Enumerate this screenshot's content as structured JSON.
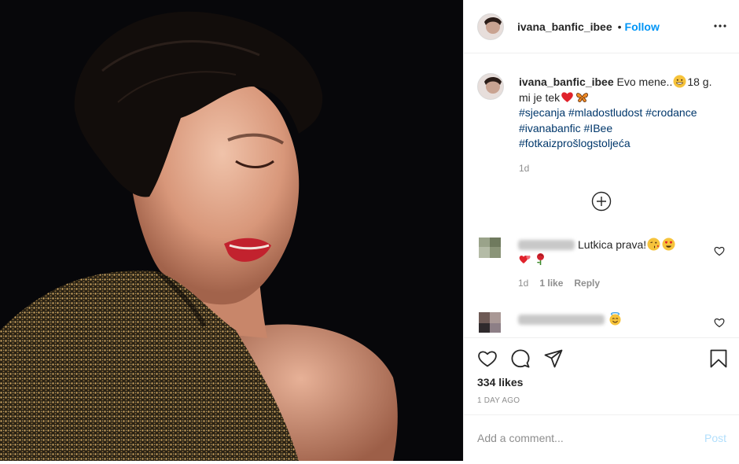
{
  "post": {
    "username": "ivana_banfic_ibee",
    "follow_label": "Follow",
    "separator": "•"
  },
  "caption": {
    "username": "ivana_banfic_ibee",
    "text_1": "Evo mene..",
    "text_2": "18 g.",
    "text_3": "mi je tek",
    "hashtags_line1": [
      "#sjecanja",
      "#mladostludost",
      "#crodance"
    ],
    "hashtags_line2": [
      "#ivanabanfic",
      "#IBee"
    ],
    "hashtags_line3": [
      "#fotkaizprošlogstoljeća"
    ],
    "time": "1d"
  },
  "comments": [
    {
      "text": "Lutkica prava!",
      "time": "1d",
      "likes": "1 like",
      "reply": "Reply"
    },
    {
      "text": ""
    }
  ],
  "actions": {
    "icons": [
      "heart-icon",
      "comment-icon",
      "share-icon",
      "bookmark-icon"
    ],
    "likes": "334 likes",
    "date": "1 DAY AGO"
  },
  "add_comment": {
    "placeholder": "Add a comment...",
    "post_label": "Post"
  },
  "colors": {
    "accent": "#0095f6",
    "post_disabled": "#b2dffc",
    "hashtag": "#00376b",
    "secondary_text": "#8e8e8e",
    "heart_red": "#ed1c24"
  }
}
